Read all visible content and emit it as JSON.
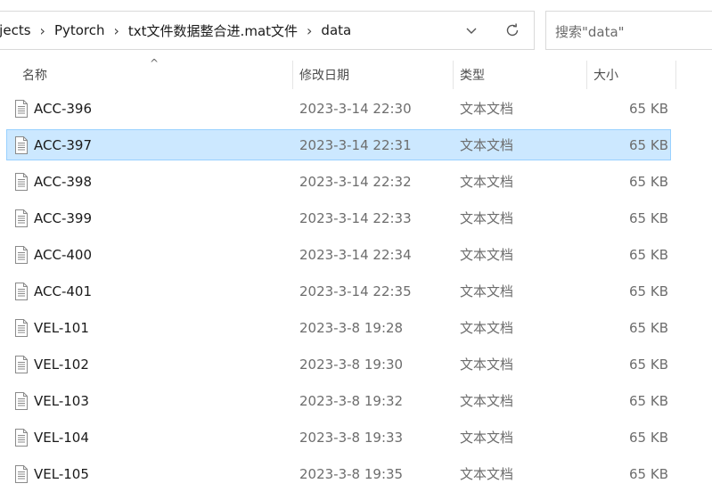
{
  "address_bar": {
    "crumbs": [
      "ojects",
      "Pytorch",
      "txt文件数据整合进.mat文件",
      "data"
    ],
    "dropdown_icon": "chevron-down-icon",
    "refresh_icon": "refresh-icon"
  },
  "search": {
    "placeholder": "搜索\"data\""
  },
  "columns": {
    "name": "名称",
    "date": "修改日期",
    "type": "类型",
    "size": "大小"
  },
  "files": [
    {
      "name": "ACC-396",
      "date": "2023-3-14 22:30",
      "type": "文本文档",
      "size": "65 KB",
      "selected": false
    },
    {
      "name": "ACC-397",
      "date": "2023-3-14 22:31",
      "type": "文本文档",
      "size": "65 KB",
      "selected": true
    },
    {
      "name": "ACC-398",
      "date": "2023-3-14 22:32",
      "type": "文本文档",
      "size": "65 KB",
      "selected": false
    },
    {
      "name": "ACC-399",
      "date": "2023-3-14 22:33",
      "type": "文本文档",
      "size": "65 KB",
      "selected": false
    },
    {
      "name": "ACC-400",
      "date": "2023-3-14 22:34",
      "type": "文本文档",
      "size": "65 KB",
      "selected": false
    },
    {
      "name": "ACC-401",
      "date": "2023-3-14 22:35",
      "type": "文本文档",
      "size": "65 KB",
      "selected": false
    },
    {
      "name": "VEL-101",
      "date": "2023-3-8 19:28",
      "type": "文本文档",
      "size": "65 KB",
      "selected": false
    },
    {
      "name": "VEL-102",
      "date": "2023-3-8 19:30",
      "type": "文本文档",
      "size": "65 KB",
      "selected": false
    },
    {
      "name": "VEL-103",
      "date": "2023-3-8 19:32",
      "type": "文本文档",
      "size": "65 KB",
      "selected": false
    },
    {
      "name": "VEL-104",
      "date": "2023-3-8 19:33",
      "type": "文本文档",
      "size": "65 KB",
      "selected": false
    },
    {
      "name": "VEL-105",
      "date": "2023-3-8 19:35",
      "type": "文本文档",
      "size": "65 KB",
      "selected": false
    }
  ],
  "colors": {
    "selection_bg": "#cce8ff",
    "selection_border": "#99d1ff"
  }
}
